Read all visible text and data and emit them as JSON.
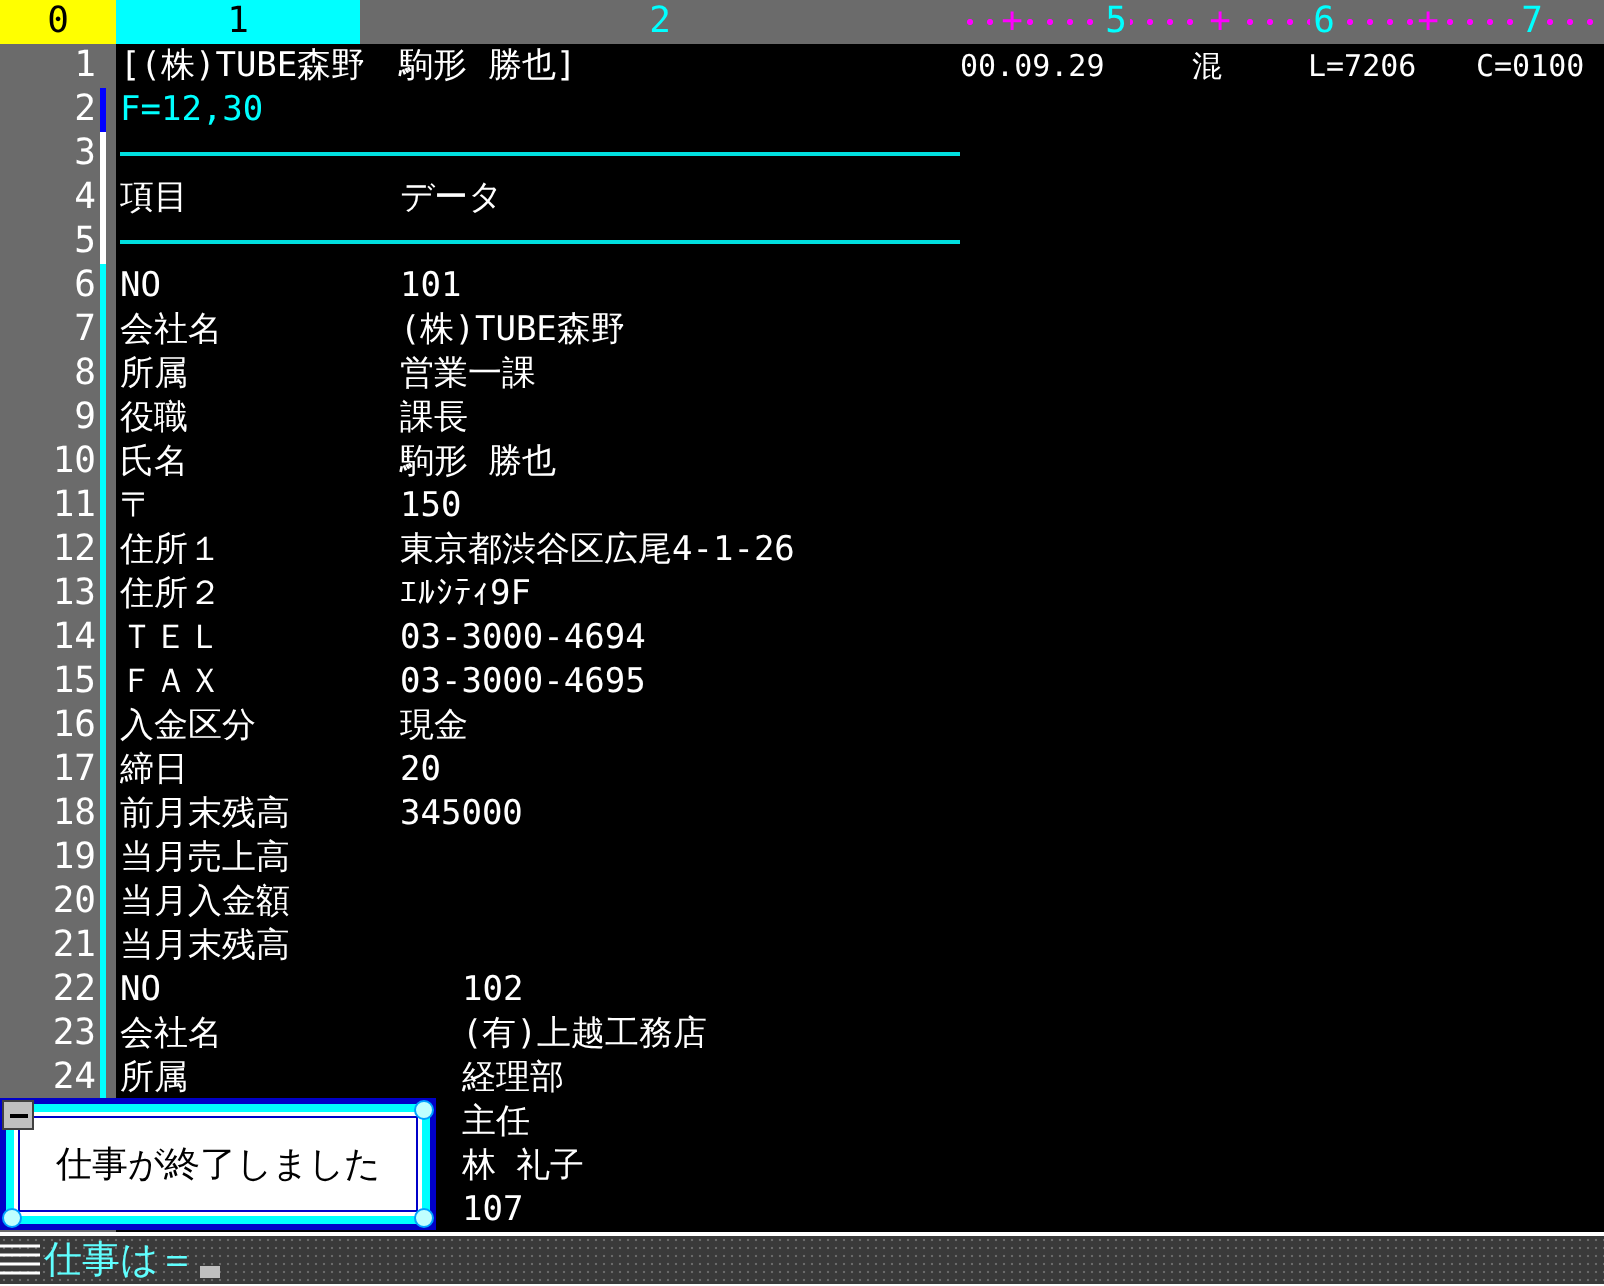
{
  "ruler": [
    {
      "label": "0",
      "kind": "line"
    },
    {
      "label": "1",
      "kind": "current"
    },
    {
      "label": "2",
      "kind": "plain"
    },
    {
      "label": "+",
      "kind": "tick"
    },
    {
      "label": "5",
      "kind": "number"
    },
    {
      "label": "+",
      "kind": "tick"
    },
    {
      "label": "6",
      "kind": "number"
    },
    {
      "label": "+",
      "kind": "tick"
    },
    {
      "label": "7",
      "kind": "number"
    }
  ],
  "lines": [
    {
      "no": "1",
      "kind": "header",
      "text": "[(株)TUBE森野　駒形 勝也]",
      "fields": [
        "00.09.29",
        "混",
        "L=7206",
        "C=0100"
      ]
    },
    {
      "no": "2",
      "kind": "format",
      "text": "F=12,30",
      "color": "#0000ff"
    },
    {
      "no": "3",
      "kind": "rule",
      "color": "#ffffff"
    },
    {
      "no": "4",
      "kind": "record",
      "item": "項目",
      "value": "データ",
      "color": "#ffffff"
    },
    {
      "no": "5",
      "kind": "rule",
      "color": "#ffffff"
    },
    {
      "no": "6",
      "kind": "record",
      "item": "NO",
      "value": "101",
      "color": "#00ffff"
    },
    {
      "no": "7",
      "kind": "record",
      "item": "会社名",
      "value": "(株)TUBE森野",
      "color": "#00ffff"
    },
    {
      "no": "8",
      "kind": "record",
      "item": "所属",
      "value": "営業一課",
      "color": "#00ffff"
    },
    {
      "no": "9",
      "kind": "record",
      "item": "役職",
      "value": "課長",
      "color": "#00ffff"
    },
    {
      "no": "10",
      "kind": "record",
      "item": "氏名",
      "value": "駒形 勝也",
      "color": "#00ffff"
    },
    {
      "no": "11",
      "kind": "record",
      "item": "〒",
      "value": "150",
      "color": "#00ffff"
    },
    {
      "no": "12",
      "kind": "record",
      "item": "住所１",
      "value": "東京都渋谷区広尾4-1-26",
      "color": "#00ffff"
    },
    {
      "no": "13",
      "kind": "record",
      "item": "住所２",
      "value": "ｴﾙｼﾃｨ9F",
      "color": "#00ffff"
    },
    {
      "no": "14",
      "kind": "record",
      "item": "ＴＥＬ",
      "value": "03-3000-4694",
      "color": "#00ffff"
    },
    {
      "no": "15",
      "kind": "record",
      "item": "ＦＡＸ",
      "value": "03-3000-4695",
      "color": "#00ffff"
    },
    {
      "no": "16",
      "kind": "record",
      "item": "入金区分",
      "value": "現金",
      "color": "#00ffff"
    },
    {
      "no": "17",
      "kind": "record",
      "item": "締日",
      "value": "20",
      "color": "#00ffff"
    },
    {
      "no": "18",
      "kind": "record",
      "item": "前月末残高",
      "value": "345000",
      "color": "#00ffff"
    },
    {
      "no": "19",
      "kind": "record",
      "item": "当月売上高",
      "color": "#00ffff"
    },
    {
      "no": "20",
      "kind": "record",
      "item": "当月入金額",
      "color": "#00ffff"
    },
    {
      "no": "21",
      "kind": "record",
      "item": "当月末残高",
      "color": "#00ffff"
    },
    {
      "no": "22",
      "kind": "wide",
      "item": "NO",
      "value": "102",
      "color": "#00ffff"
    },
    {
      "no": "23",
      "kind": "wide",
      "item": "会社名",
      "value": "(有)上越工務店",
      "color": "#00ffff"
    },
    {
      "no": "24",
      "kind": "wide",
      "item": "所属",
      "value": "経理部",
      "color": "#00ffff"
    },
    {
      "kind": "wide",
      "value": "主任"
    },
    {
      "kind": "wide",
      "value": "林 礼子"
    },
    {
      "kind": "wide",
      "value": "107"
    }
  ],
  "dialog": {
    "message": "仕事が終了しました"
  },
  "command_line": {
    "prompt": "仕事は＝"
  }
}
